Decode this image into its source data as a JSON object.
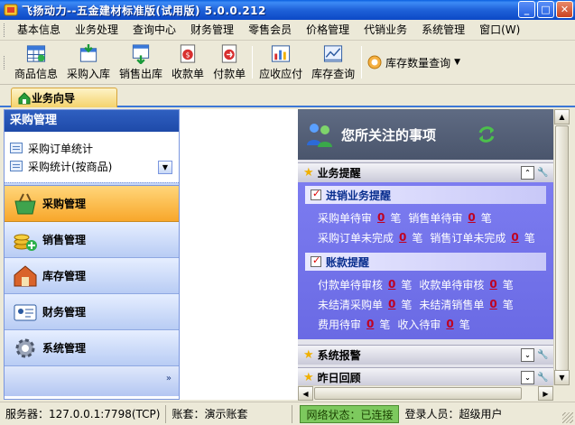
{
  "window": {
    "title": "飞扬动力--五金建材标准版(试用版)   5.0.0.212",
    "min_glyph": "_",
    "max_glyph": "□",
    "close_glyph": "✕"
  },
  "menu": [
    "基本信息",
    "业务处理",
    "查询中心",
    "财务管理",
    "零售会员",
    "价格管理",
    "代销业务",
    "系统管理",
    "窗口(W)"
  ],
  "toolbar": {
    "buttons": [
      "商品信息",
      "采购入库",
      "销售出库",
      "收款单",
      "付款单",
      "应收应付",
      "库存查询"
    ],
    "dropdown_label": "库存数量查询",
    "dropdown_caret": "▼"
  },
  "tab": {
    "label": "业务向导"
  },
  "left": {
    "header": "采购管理",
    "list": [
      "采购订单统计",
      "采购统计(按商品)"
    ],
    "scroll_glyph": "▼",
    "nav": [
      "采购管理",
      "销售管理",
      "库存管理",
      "财务管理",
      "系统管理"
    ],
    "more_glyph": "»"
  },
  "right": {
    "title": "您所关注的事项",
    "sections": {
      "reminders": {
        "title": "业务提醒",
        "sub1": "进销业务提醒",
        "row1": {
          "a": "采购单待审",
          "a_num": "0",
          "a_unit": "笔",
          "b": "销售单待审",
          "b_num": "0",
          "b_unit": "笔"
        },
        "row2": {
          "a": "采购订单未完成",
          "a_num": "0",
          "a_unit": "笔",
          "b": "销售订单未完成",
          "b_num": "0",
          "b_unit": "笔"
        },
        "sub2": "账款提醒",
        "row3": {
          "a": "付款单待审核",
          "a_num": "0",
          "a_unit": "笔",
          "b": "收款单待审核",
          "b_num": "0",
          "b_unit": "笔"
        },
        "row4": {
          "a": "未结清采购单",
          "a_num": "0",
          "a_unit": "笔",
          "b": "未结清销售单",
          "b_num": "0",
          "b_unit": "笔"
        },
        "row5": {
          "a": "费用待审",
          "a_num": "0",
          "a_unit": "笔",
          "b": "收入待审",
          "b_num": "0",
          "b_unit": "笔"
        }
      },
      "alarm": {
        "title": "系统报警"
      },
      "review": {
        "title": "昨日回顾"
      }
    },
    "collapse_up_glyph": "⌃",
    "collapse_down_glyph": "⌄"
  },
  "status": {
    "server": "服务器：127.0.0.1:7798(TCP)",
    "account": "账套：演示账套",
    "network": "网络状态：已连接",
    "user": "登录人员：超级用户"
  },
  "colors": {
    "accent": "#1f62d9",
    "nav_active": "#f8a72b",
    "reminder_bg": "#7c7cf0",
    "status_ok": "#7dc95e"
  },
  "icons": {
    "title": "app-icon",
    "tab": "home-icon",
    "people": "users-icon",
    "refresh": "refresh-icon",
    "star": "star-icon"
  }
}
